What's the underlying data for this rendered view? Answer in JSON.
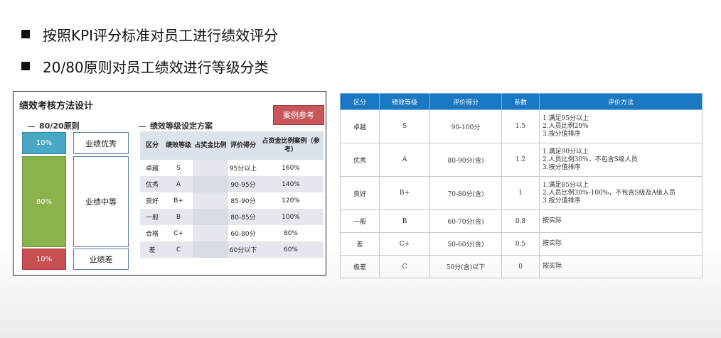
{
  "bullets": [
    "按照KPI评分标准对员工进行绩效评分",
    "20/80原则对员工绩效进行等级分类"
  ],
  "panel": {
    "title": "绩效考核方法设计",
    "rule_label": "80/20原则",
    "case_button": "案例参考",
    "bars": {
      "top": "10%",
      "middle": "80%",
      "bottom": "10%"
    },
    "levels": {
      "top": "业绩优秀",
      "middle": "业绩中等",
      "bottom": "业绩差"
    },
    "grade_title": "绩效等级设定方案",
    "grade_headers": [
      "区分",
      "绩效等级",
      "占奖金比例",
      "评价得分",
      "占资金比例案例（参考）"
    ],
    "grade_rows": [
      [
        "卓越",
        "S",
        "",
        "95分以上",
        "160%"
      ],
      [
        "优秀",
        "A",
        "",
        "90-95分",
        "140%"
      ],
      [
        "良好",
        "B+",
        "",
        "85-90分",
        "120%"
      ],
      [
        "一般",
        "B",
        "",
        "80-85分",
        "100%"
      ],
      [
        "合格",
        "C+",
        "",
        "60-80分",
        "80%"
      ],
      [
        "差",
        "C",
        "",
        "60分以下",
        "60%"
      ]
    ]
  },
  "table": {
    "headers": [
      "区分",
      "绩效等级",
      "评价得分",
      "系数",
      "评价方法"
    ],
    "rows": [
      {
        "cells": [
          "卓越",
          "S",
          "90-100分",
          "1.5"
        ],
        "method": [
          "1.满足95分以上",
          "2.人员比例20%",
          "3.按分值排序"
        ]
      },
      {
        "cells": [
          "优秀",
          "A",
          "80-90分(含)",
          "1.2"
        ],
        "method": [
          "1.满足90分以上",
          "2.人员比例30%，不包含S级人员",
          "3.按分值排序"
        ]
      },
      {
        "cells": [
          "良好",
          "B+",
          "70-80分(含)",
          "1"
        ],
        "method": [
          "1.满足85分以上",
          "2.人员比例30%-100%，不包含S级及A级人员",
          "3.按分值排序"
        ]
      },
      {
        "cells": [
          "一般",
          "B",
          "60-70分(含)",
          "0.8"
        ],
        "method": [
          "按实际"
        ]
      },
      {
        "cells": [
          "差",
          "C+",
          "50-60分(含)",
          "0.5"
        ],
        "method": [
          "按实际"
        ]
      },
      {
        "cells": [
          "极差",
          "C",
          "50分(含)以下",
          "0"
        ],
        "method": [
          "按实际"
        ]
      }
    ]
  }
}
